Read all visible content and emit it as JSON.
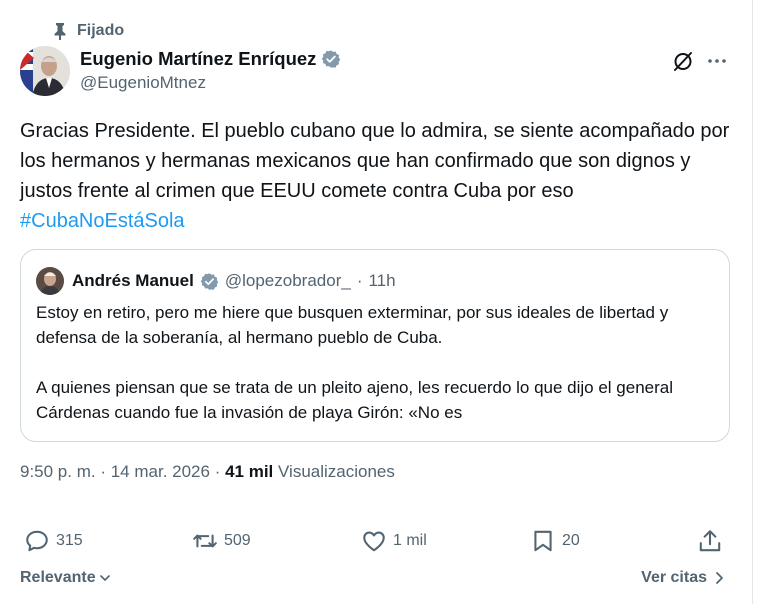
{
  "pinned_label": "Fijado",
  "author": {
    "name": "Eugenio Martínez Enríquez",
    "handle": "@EugenioMtnez"
  },
  "tweet": {
    "text": "Gracias Presidente. El pueblo cubano que lo admira, se siente acompañado por los hermanos y hermanas mexicanos que han confirmado que son dignos y justos frente al crimen que EEUU comete contra Cuba por eso ",
    "hashtag": "#CubaNoEstáSola"
  },
  "quote": {
    "name": "Andrés Manuel",
    "handle": "@lopezobrador_",
    "separator": " · ",
    "time": "11h",
    "paragraph1": "Estoy en retiro, pero me hiere que busquen exterminar, por sus ideales de libertad y defensa de la soberanía, al hermano pueblo de Cuba.",
    "paragraph2": "A quienes piensan que se trata de un pleito ajeno, les recuerdo lo que dijo el general Cárdenas cuando fue la invasión de playa Girón: «No es"
  },
  "meta": {
    "time": "9:50 p. m.",
    "dot": " · ",
    "date": "14 mar. 2026",
    "views_count": "41 mil",
    "views_label": "Visualizaciones"
  },
  "actions": {
    "replies": "315",
    "reposts": "509",
    "likes": "1 mil",
    "bookmarks": "20"
  },
  "bottom": {
    "sort_label": "Relevante",
    "quotes_label": "Ver citas"
  },
  "colors": {
    "link": "#1d9bf0",
    "secondary_text": "#536471",
    "border": "#cfd9de",
    "verified_gray": "#829aab"
  }
}
